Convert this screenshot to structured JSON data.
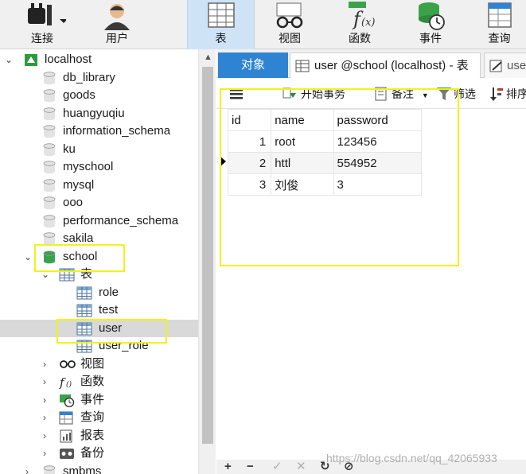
{
  "toolbar": {
    "connect": "连接",
    "user": "用户",
    "table": "表",
    "view": "视图",
    "function": "函数",
    "event": "事件",
    "query": "查询"
  },
  "tree": {
    "root": "localhost",
    "databases": [
      "db_library",
      "goods",
      "huangyuqiu",
      "information_schema",
      "ku",
      "myschool",
      "mysql",
      "ooo",
      "performance_schema",
      "sakila"
    ],
    "school": {
      "name": "school",
      "tables_label": "表",
      "tables": [
        "role",
        "test",
        "user",
        "user_role"
      ],
      "selected_table": "user",
      "groups": [
        "视图",
        "函数",
        "事件",
        "查询",
        "报表",
        "备份"
      ]
    },
    "next_db": "smbms"
  },
  "tabs": {
    "objects": "对象",
    "user_table": "user @school (localhost) - 表",
    "partial": "use"
  },
  "subbar": {
    "begin_transaction": "开始事务",
    "notes": "备注",
    "filter": "筛选",
    "sort": "排序"
  },
  "grid": {
    "columns": [
      "id",
      "name",
      "password"
    ],
    "rows": [
      {
        "id": "1",
        "name": "root",
        "password": "123456"
      },
      {
        "id": "2",
        "name": "httl",
        "password": "554952"
      },
      {
        "id": "3",
        "name": "刘俊",
        "password": "3"
      }
    ]
  },
  "watermark": "https://blog.csdn.net/qq_42065933",
  "colors": {
    "accent": "#2f83d3",
    "highlight": "#f2f21a",
    "selected_row": "#d9d9d9",
    "toolbar_active": "#cfe3f7"
  }
}
